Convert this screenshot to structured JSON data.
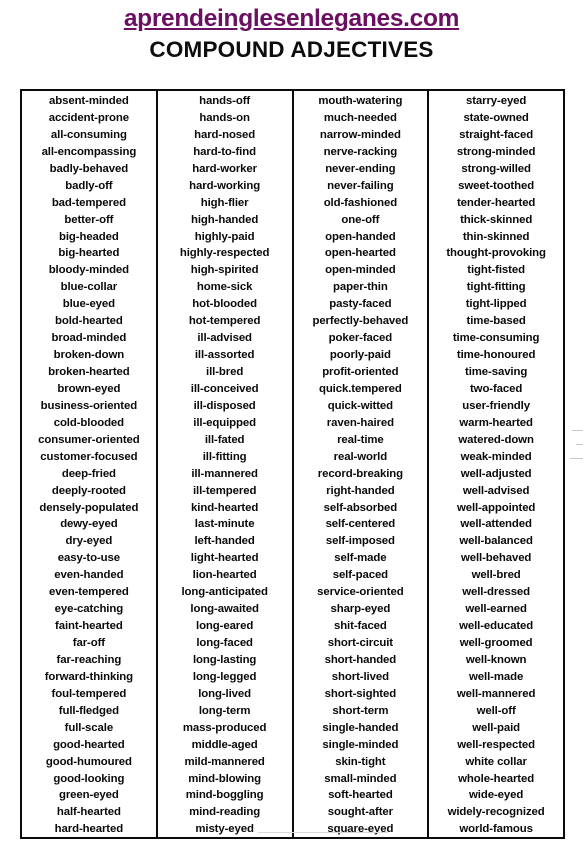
{
  "header": {
    "site_link": "aprendeinglesenleganes.com",
    "link_color": "#6b1060",
    "title": "COMPOUND ADJECTIVES",
    "title_color": "#0d0d0d"
  },
  "table": {
    "border_color": "#0a0a0a",
    "column_count": 4,
    "row_count": 44,
    "columns": [
      {
        "name": "column-1",
        "items": [
          "absent-minded",
          "accident-prone",
          "all-consuming",
          "all-encompassing",
          "badly-behaved",
          "badly-off",
          "bad-tempered",
          "better-off",
          "big-headed",
          "big-hearted",
          "bloody-minded",
          "blue-collar",
          "blue-eyed",
          "bold-hearted",
          "broad-minded",
          "broken-down",
          "broken-hearted",
          "brown-eyed",
          "business-oriented",
          "cold-blooded",
          "consumer-oriented",
          "customer-focused",
          "deep-fried",
          "deeply-rooted",
          "densely-populated",
          "dewy-eyed",
          "dry-eyed",
          "easy-to-use",
          "even-handed",
          "even-tempered",
          "eye-catching",
          "faint-hearted",
          "far-off",
          "far-reaching",
          "forward-thinking",
          "foul-tempered",
          "full-fledged",
          "full-scale",
          "good-hearted",
          "good-humoured",
          "good-looking",
          "green-eyed",
          "half-hearted",
          "hard-hearted"
        ]
      },
      {
        "name": "column-2",
        "items": [
          "hands-off",
          "hands-on",
          "hard-nosed",
          "hard-to-find",
          "hard-worker",
          "hard-working",
          "high-flier",
          "high-handed",
          "highly-paid",
          "highly-respected",
          "high-spirited",
          "home-sick",
          "hot-blooded",
          "hot-tempered",
          "ill-advised",
          "ill-assorted",
          "ill-bred",
          "ill-conceived",
          "ill-disposed",
          "ill-equipped",
          "ill-fated",
          "ill-fitting",
          "ill-mannered",
          "ill-tempered",
          "kind-hearted",
          "last-minute",
          "left-handed",
          "light-hearted",
          "lion-hearted",
          "long-anticipated",
          "long-awaited",
          "long-eared",
          "long-faced",
          "long-lasting",
          "long-legged",
          "long-lived",
          "long-term",
          "mass-produced",
          "middle-aged",
          "mild-mannered",
          "mind-blowing",
          "mind-boggling",
          "mind-reading",
          "misty-eyed"
        ]
      },
      {
        "name": "column-3",
        "items": [
          "mouth-watering",
          "much-needed",
          "narrow-minded",
          "nerve-racking",
          "never-ending",
          "never-failing",
          "old-fashioned",
          "one-off",
          "open-handed",
          "open-hearted",
          "open-minded",
          "paper-thin",
          "pasty-faced",
          "perfectly-behaved",
          "poker-faced",
          "poorly-paid",
          "profit-oriented",
          "quick.tempered",
          "quick-witted",
          "raven-haired",
          "real-time",
          "real-world",
          "record-breaking",
          "right-handed",
          "self-absorbed",
          "self-centered",
          "self-imposed",
          "self-made",
          "self-paced",
          "service-oriented",
          "sharp-eyed",
          "shit-faced",
          "short-circuit",
          "short-handed",
          "short-lived",
          "short-sighted",
          "short-term",
          "single-handed",
          "single-minded",
          "skin-tight",
          "small-minded",
          "soft-hearted",
          "sought-after",
          "square-eyed"
        ]
      },
      {
        "name": "column-4",
        "items": [
          "starry-eyed",
          "state-owned",
          "straight-faced",
          "strong-minded",
          "strong-willed",
          "sweet-toothed",
          "tender-hearted",
          "thick-skinned",
          "thin-skinned",
          "thought-provoking",
          "tight-fisted",
          "tight-fitting",
          "tight-lipped",
          "time-based",
          "time-consuming",
          "time-honoured",
          "time-saving",
          "two-faced",
          "user-friendly",
          "warm-hearted",
          "watered-down",
          "weak-minded",
          "well-adjusted",
          "well-advised",
          "well-appointed",
          "well-attended",
          "well-balanced",
          "well-behaved",
          "well-bred",
          "well-dressed",
          "well-earned",
          "well-educated",
          "well-groomed",
          "well-known",
          "well-made",
          "well-mannered",
          "well-off",
          "well-paid",
          "well-respected",
          "white collar",
          "whole-hearted",
          "wide-eyed",
          "widely-recognized",
          "world-famous"
        ]
      }
    ]
  }
}
